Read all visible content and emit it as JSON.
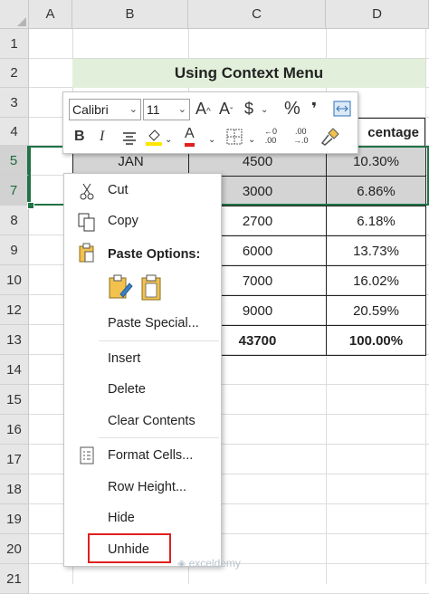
{
  "columns": [
    "A",
    "B",
    "C",
    "D"
  ],
  "rows": [
    "1",
    "2",
    "3",
    "4",
    "5",
    "7",
    "8",
    "9",
    "10",
    "12",
    "13",
    "14",
    "15",
    "16",
    "17",
    "18",
    "19",
    "20",
    "21"
  ],
  "title": "Using Context Menu",
  "header_partial": "centage",
  "table_rows": [
    {
      "b": "JAN",
      "c": "4500",
      "d": "10.30%"
    },
    {
      "b": "",
      "c": "3000",
      "d": "6.86%"
    },
    {
      "b": "",
      "c": "2700",
      "d": "6.18%"
    },
    {
      "b": "",
      "c": "6000",
      "d": "13.73%"
    },
    {
      "b": "",
      "c": "7000",
      "d": "16.02%"
    },
    {
      "b": "",
      "c": "9000",
      "d": "20.59%"
    },
    {
      "b": "",
      "c": "43700",
      "d": "100.00%"
    }
  ],
  "mini_toolbar": {
    "font": "Calibri",
    "size": "11",
    "grow": "A",
    "shrink": "A",
    "currency": "$",
    "percent": "%",
    "comma": "❜",
    "bold": "B",
    "italic": "I",
    "font_color": "A",
    "inc_decimal": ".00",
    "dec_decimal": ".00"
  },
  "menu": {
    "cut": "Cut",
    "copy": "Copy",
    "paste_options": "Paste Options:",
    "paste_special": "Paste Special...",
    "insert": "Insert",
    "delete": "Delete",
    "clear_contents": "Clear Contents",
    "format_cells": "Format Cells...",
    "row_height": "Row Height...",
    "hide": "Hide",
    "unhide": "Unhide"
  },
  "watermark": "exceldemy",
  "colors": {
    "title_bg": "#e2efda",
    "selection": "#217346",
    "highlight_box": "#e02020",
    "grey_row": "#d4d4d4"
  }
}
